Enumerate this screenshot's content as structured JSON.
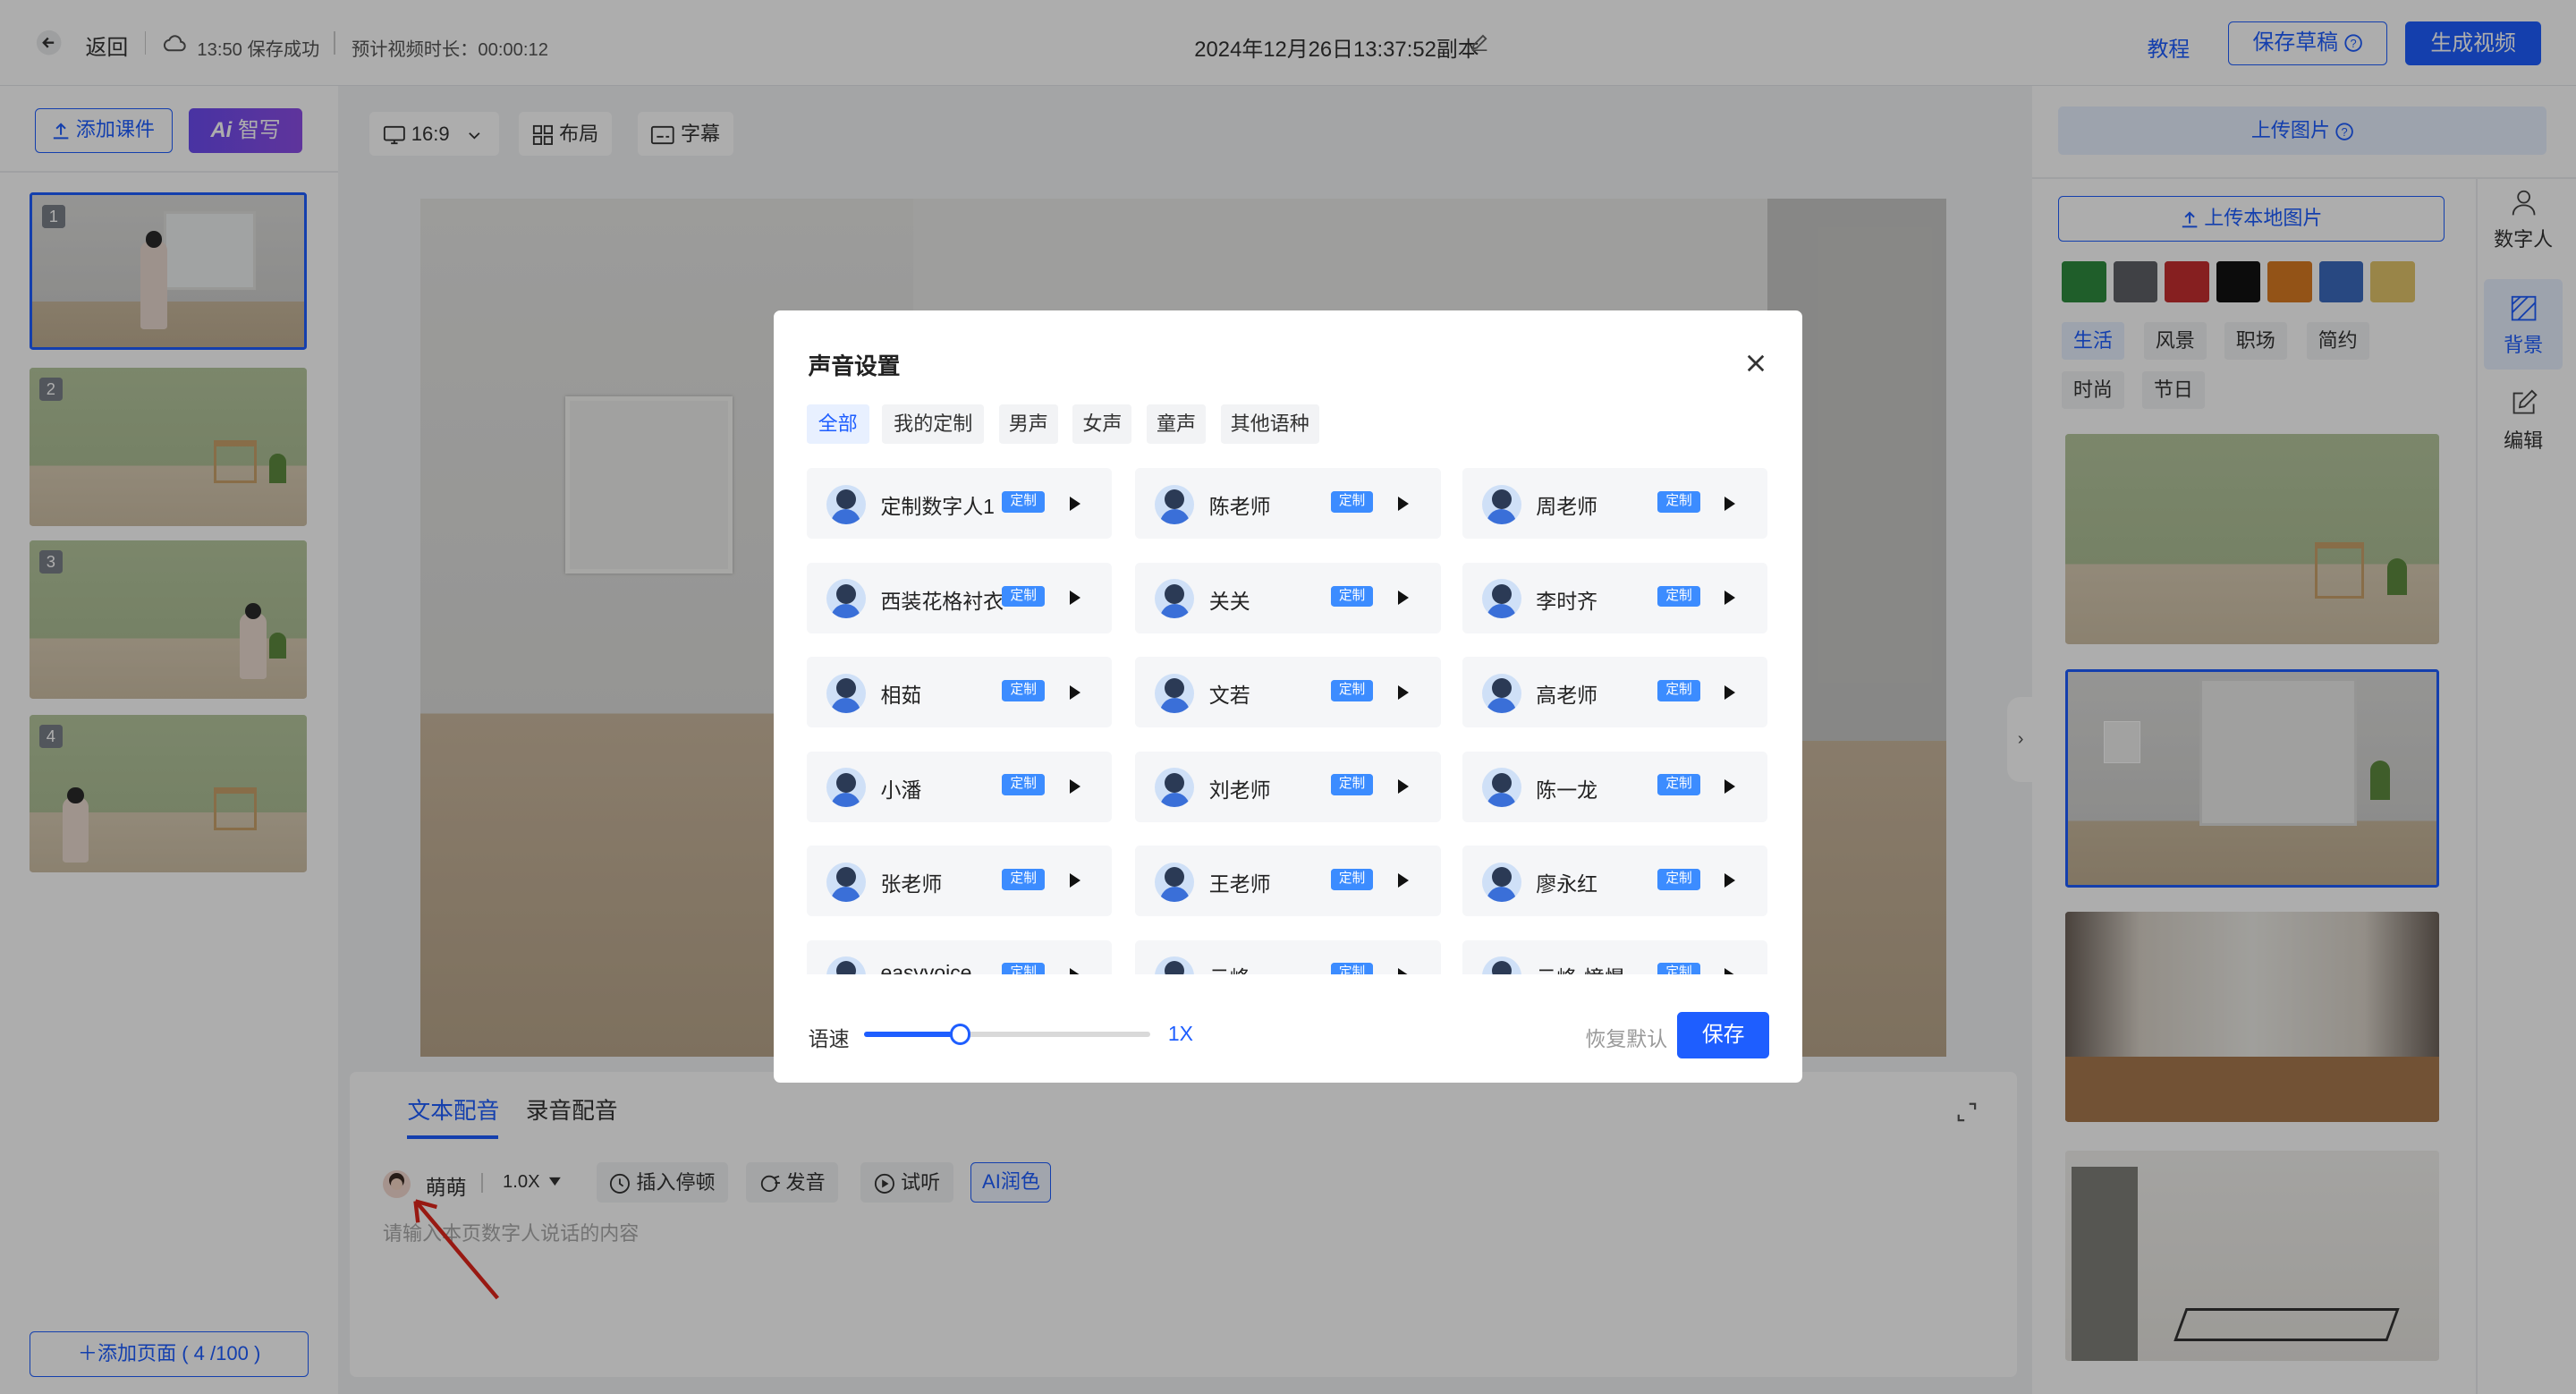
{
  "topbar": {
    "back": "返回",
    "save_status": "13:50 保存成功",
    "duration_label": "预计视频时长：00:00:12",
    "doc_title": "2024年12月26日13:37:52副本",
    "tutorial": "教程",
    "save_draft": "保存草稿",
    "generate": "生成视频"
  },
  "left": {
    "add_courseware": "添加课件",
    "ai_write": "智写",
    "ai_badge": "Ai",
    "pages": [
      "1",
      "2",
      "3",
      "4"
    ],
    "add_page": "添加页面 ( 4 /100 )"
  },
  "toolbar": {
    "ratio": "16:9",
    "layout": "布局",
    "subtitle": "字幕"
  },
  "editor": {
    "tabs": [
      "文本配音",
      "录音配音"
    ],
    "voice": "萌萌",
    "speed": "1.0X",
    "insert_pause": "插入停顿",
    "pronounce": "发音",
    "listen": "试听",
    "ai_polish": "AI润色",
    "placeholder": "请输入本页数字人说话的内容"
  },
  "right": {
    "upload_image": "上传图片",
    "upload_local": "上传本地图片",
    "colors": [
      "#2e8b3e",
      "#5f6166",
      "#c62f30",
      "#121212",
      "#d97b22",
      "#3c6bbf",
      "#e2c56a"
    ],
    "tags_row1": [
      "生活",
      "风景",
      "职场",
      "简约"
    ],
    "tags_row2": [
      "时尚",
      "节日"
    ],
    "rail": [
      "数字人",
      "背景",
      "编辑"
    ]
  },
  "modal": {
    "title": "声音设置",
    "tabs": [
      "全部",
      "我的定制",
      "男声",
      "女声",
      "童声",
      "其他语种"
    ],
    "badge": "定制",
    "voices": [
      "定制数字人1",
      "陈老师",
      "周老师",
      "西装花格衬衣",
      "关关",
      "李时齐",
      "相茹",
      "文若",
      "高老师",
      "小潘",
      "刘老师",
      "陈一龙",
      "张老师",
      "王老师",
      "廖永红",
      "easyvoice",
      "云峰",
      "云峰-憧憬"
    ],
    "speed_label": "语速",
    "speed_value": "1X",
    "reset": "恢复默认",
    "save": "保存"
  }
}
